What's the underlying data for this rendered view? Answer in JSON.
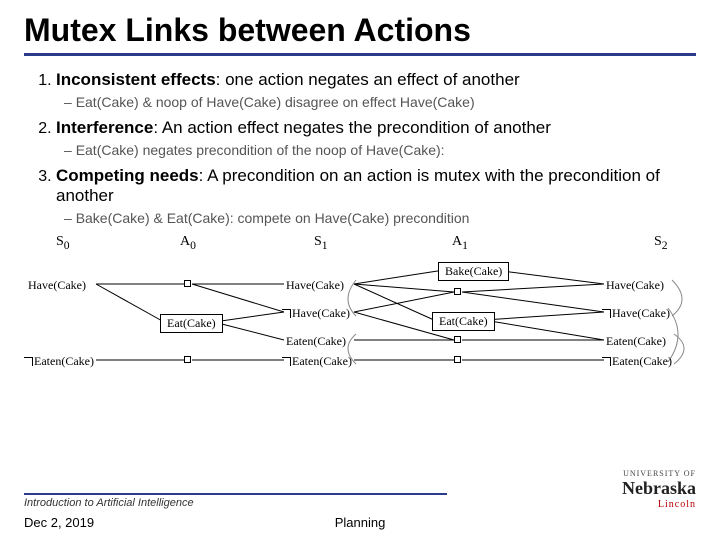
{
  "title": "Mutex Links between Actions",
  "points": [
    {
      "lead": "Inconsistent effects",
      "rest": ": one action negates an effect of another",
      "sub": "Eat(Cake) & noop of Have(Cake) disagree on effect Have(Cake)"
    },
    {
      "lead": "Interference",
      "rest": ": An action effect negates the precondition of another",
      "sub": "Eat(Cake) negates precondition of the noop of Have(Cake):"
    },
    {
      "lead": "Competing needs",
      "rest": ": A precondition on an action is mutex with the precondition of another",
      "sub": "Bake(Cake) & Eat(Cake): compete on Have(Cake) precondition"
    }
  ],
  "graph": {
    "cols": {
      "s0": "S",
      "a0": "A",
      "s1": "S",
      "a1": "A",
      "s2": "S",
      "s0i": "0",
      "a0i": "0",
      "s1i": "1",
      "a1i": "1",
      "s2i": "2"
    },
    "labels": {
      "have": "Have(Cake)",
      "eat": "Eat(Cake)",
      "neaten": "Eaten(Cake)",
      "nhave": "Have(Cake)",
      "eaten": "Eaten(Cake)",
      "bake": "Bake(Cake)"
    }
  },
  "footer": {
    "course": "Introduction to Artificial Intelligence",
    "date": "Dec 2, 2019",
    "topic": "Planning"
  },
  "logo": {
    "u": "UNIVERSITY OF",
    "n": "Nebraska",
    "l": "Lincoln"
  }
}
